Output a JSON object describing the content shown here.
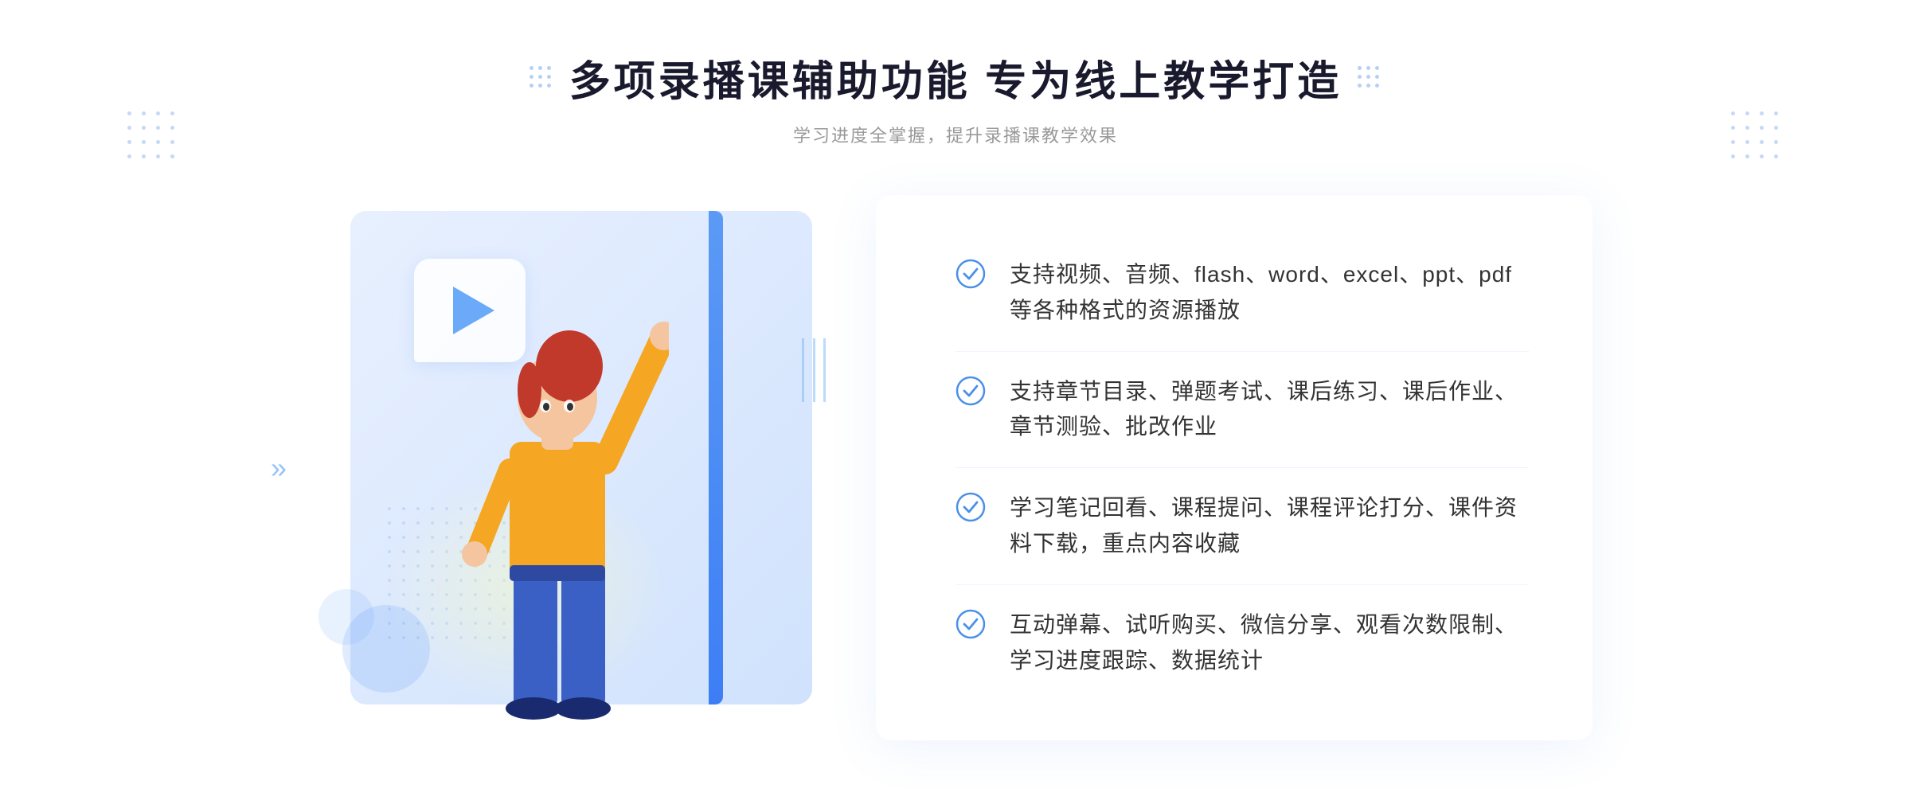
{
  "header": {
    "main_title": "多项录播课辅助功能 专为线上教学打造",
    "sub_title": "学习进度全掌握，提升录播课教学效果"
  },
  "features": [
    {
      "id": "feature-1",
      "text": "支持视频、音频、flash、word、excel、ppt、pdf等各种格式的资源播放"
    },
    {
      "id": "feature-2",
      "text": "支持章节目录、弹题考试、课后练习、课后作业、章节测验、批改作业"
    },
    {
      "id": "feature-3",
      "text": "学习笔记回看、课程提问、课程评论打分、课件资料下载，重点内容收藏"
    },
    {
      "id": "feature-4",
      "text": "互动弹幕、试听购买、微信分享、观看次数限制、学习进度跟踪、数据统计"
    }
  ],
  "colors": {
    "primary_blue": "#4a90e8",
    "light_blue": "#6aaaf8",
    "bg_gradient_start": "#e8f0fe",
    "bg_gradient_end": "#d0e2fd",
    "title_color": "#1a1a2e",
    "text_color": "#333333",
    "subtitle_color": "#999999"
  },
  "icons": {
    "check": "circle-check",
    "play": "play-triangle",
    "chevron": "double-chevron-right"
  }
}
